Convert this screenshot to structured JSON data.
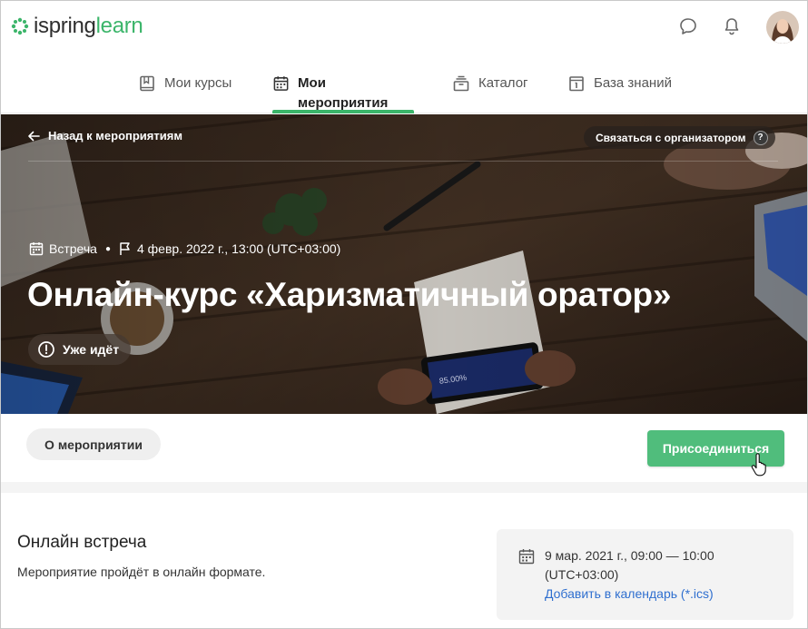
{
  "app": {
    "logo_part1": "ispring",
    "logo_part2": "learn",
    "brand_color": "#3bb56a"
  },
  "nav": {
    "tabs": [
      {
        "label": "Мои курсы",
        "icon": "book-icon",
        "active": false
      },
      {
        "label": "Мои мероприятия",
        "icon": "calendar-icon",
        "active": true
      },
      {
        "label": "Каталог",
        "icon": "catalog-icon",
        "active": false
      },
      {
        "label": "База знаний",
        "icon": "knowledge-icon",
        "active": false
      }
    ]
  },
  "hero": {
    "back_label": "Назад к мероприятиям",
    "contact_label": "Связаться с организатором",
    "contact_help": "?",
    "event_type": "Встреча",
    "event_start": "4 февр. 2022 г., 13:00 (UTC+03:00)",
    "title": "Онлайн-курс «Харизматичный оратор»",
    "status": "Уже идёт"
  },
  "actions": {
    "about_label": "О мероприятии",
    "join_label": "Присоединиться"
  },
  "details": {
    "title": "Онлайн встреча",
    "description": "Мероприятие пройдёт в онлайн формате.",
    "date_line1": "9 мар. 2021 г., 09:00 — 10:00",
    "date_line2": "(UTC+03:00)",
    "calendar_link": "Добавить в календарь (*.ics)"
  }
}
